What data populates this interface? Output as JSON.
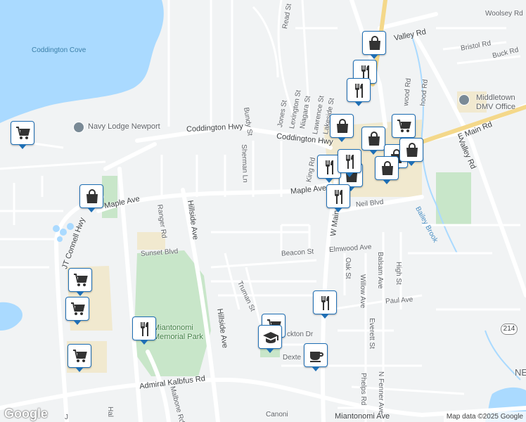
{
  "map": {
    "attribution": "Map data ©2025 Google",
    "logo": "Google",
    "water_labels": [
      {
        "id": "coddington-cove",
        "text": "Coddington Cove"
      }
    ],
    "brook_labels": [
      {
        "id": "bailey-brook",
        "text": "Bailey Brook"
      }
    ],
    "place_labels": [
      {
        "id": "park",
        "text": "Miantonomi\nMemorial Park"
      },
      {
        "id": "ne-fragment",
        "text": "NE"
      }
    ],
    "poi_labels": [
      {
        "id": "navy-lodge",
        "text": "Navy Lodge Newport"
      },
      {
        "id": "dmv",
        "text": "Middletown\nDMV Office"
      }
    ],
    "streets": [
      {
        "id": "woolsey-rd",
        "text": "Woolsey Rd"
      },
      {
        "id": "valley-rd-top",
        "text": "Valley Rd"
      },
      {
        "id": "bristol-rd",
        "text": "Bristol Rd"
      },
      {
        "id": "buck-rd",
        "text": "Buck Rd"
      },
      {
        "id": "read-st",
        "text": "Read St"
      },
      {
        "id": "bundy-st",
        "text": "Bundy St"
      },
      {
        "id": "jones-st",
        "text": "Jones St"
      },
      {
        "id": "lexington-st",
        "text": "Lexington St"
      },
      {
        "id": "niagara-st",
        "text": "Niagara St"
      },
      {
        "id": "lawrence-st",
        "text": "Lawrence St"
      },
      {
        "id": "lakeside-st",
        "text": "Lakeside St"
      },
      {
        "id": "coddington-hwy-1",
        "text": "Coddington Hwy"
      },
      {
        "id": "coddington-hwy-2",
        "text": "Coddington Hwy"
      },
      {
        "id": "sherman-ln",
        "text": "Sherman Ln"
      },
      {
        "id": "king-rd",
        "text": "King Rd"
      },
      {
        "id": "maple-ave-east",
        "text": "Maple Ave"
      },
      {
        "id": "maple-ave-west",
        "text": "Maple Ave"
      },
      {
        "id": "jt-connell-hwy",
        "text": "JT Connell Hwy"
      },
      {
        "id": "ranger-rd",
        "text": "Ranger Rd"
      },
      {
        "id": "hillside-ave-north",
        "text": "Hillside Ave"
      },
      {
        "id": "sunset-blvd",
        "text": "Sunset Blvd"
      },
      {
        "id": "beacon-st",
        "text": "Beacon St"
      },
      {
        "id": "elmwood-ave",
        "text": "Elmwood Ave"
      },
      {
        "id": "oak-st",
        "text": "Oak St"
      },
      {
        "id": "willow-ave",
        "text": "Willow Ave"
      },
      {
        "id": "balsam-ave",
        "text": "Balsam Ave"
      },
      {
        "id": "high-st",
        "text": "High St"
      },
      {
        "id": "paul-ave",
        "text": "Paul Ave"
      },
      {
        "id": "everett-st",
        "text": "Everett St"
      },
      {
        "id": "truman-st",
        "text": "Truman St"
      },
      {
        "id": "hillside-ave-south",
        "text": "Hillside Ave"
      },
      {
        "id": "dexter-fragment",
        "text": "Dexte"
      },
      {
        "id": "ackton-dr",
        "text": "ckton Dr"
      },
      {
        "id": "w-main-rd",
        "text": "W Main Rd"
      },
      {
        "id": "neil-blvd",
        "text": "Neil Blvd"
      },
      {
        "id": "e-main-rd",
        "text": "E Main Rd"
      },
      {
        "id": "valley-rd-east",
        "text": "Valley Rd"
      },
      {
        "id": "admiral-kalbfus-rd",
        "text": "Admiral Kalbfus Rd"
      },
      {
        "id": "malbone-rd",
        "text": "Malbone Rd"
      },
      {
        "id": "phelps-rd",
        "text": "Phelps Rd"
      },
      {
        "id": "n-fenner-ave",
        "text": "N Fenner Ave"
      },
      {
        "id": "miantonomi-ave",
        "text": "Miantonomi Ave"
      },
      {
        "id": "canonicus-fragment",
        "text": "Canoni"
      },
      {
        "id": "hal-fragment",
        "text": "Hal"
      },
      {
        "id": "j-fragment",
        "text": "J"
      },
      {
        "id": "greenwood-rd",
        "text": "wood Rd"
      },
      {
        "id": "shawood-rd",
        "text": "hood Rd"
      }
    ],
    "route_badges": [
      {
        "id": "route-214",
        "text": "214"
      }
    ],
    "pins": [
      {
        "id": "pin-grocery-1",
        "icon": "cart-icon"
      },
      {
        "id": "pin-grocery-2",
        "icon": "cart-icon"
      },
      {
        "id": "pin-grocery-3",
        "icon": "cart-icon"
      },
      {
        "id": "pin-grocery-4",
        "icon": "cart-icon"
      },
      {
        "id": "pin-grocery-5",
        "icon": "cart-icon"
      },
      {
        "id": "pin-grocery-6",
        "icon": "cart-icon"
      },
      {
        "id": "pin-shopping-1",
        "icon": "bag-icon"
      },
      {
        "id": "pin-shopping-2",
        "icon": "bag-icon"
      },
      {
        "id": "pin-shopping-3",
        "icon": "bag-icon"
      },
      {
        "id": "pin-shopping-4",
        "icon": "bag-icon"
      },
      {
        "id": "pin-shopping-5",
        "icon": "bag-icon"
      },
      {
        "id": "pin-shopping-6",
        "icon": "bag-icon"
      },
      {
        "id": "pin-shopping-7",
        "icon": "bag-icon"
      },
      {
        "id": "pin-restaurant-1",
        "icon": "fork-knife-icon"
      },
      {
        "id": "pin-restaurant-2",
        "icon": "fork-knife-icon"
      },
      {
        "id": "pin-restaurant-3",
        "icon": "fork-knife-icon"
      },
      {
        "id": "pin-restaurant-4",
        "icon": "fork-knife-icon"
      },
      {
        "id": "pin-restaurant-5",
        "icon": "fork-knife-icon"
      },
      {
        "id": "pin-restaurant-6",
        "icon": "fork-knife-icon"
      },
      {
        "id": "pin-restaurant-7",
        "icon": "fork-knife-icon"
      },
      {
        "id": "pin-school-1",
        "icon": "graduation-cap-icon"
      },
      {
        "id": "pin-cafe-1",
        "icon": "coffee-cup-icon"
      }
    ]
  }
}
